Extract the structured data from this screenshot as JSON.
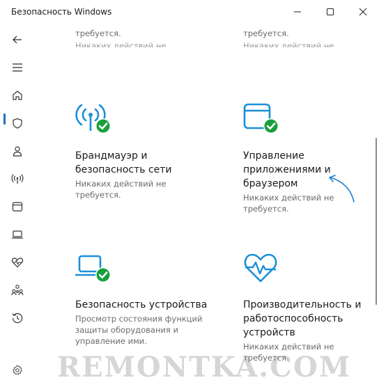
{
  "window": {
    "title": "Безопасность Windows"
  },
  "colors": {
    "accent": "#1f6fbf",
    "check": "#17a03b",
    "icon_blue": "#1a8fd8"
  },
  "sidebar": {
    "items": [
      {
        "icon": "back-arrow-icon"
      },
      {
        "icon": "menu-icon"
      },
      {
        "icon": "home-icon"
      },
      {
        "icon": "shield-icon"
      },
      {
        "icon": "account-icon"
      },
      {
        "icon": "wifi-antenna-icon"
      },
      {
        "icon": "app-browser-icon"
      },
      {
        "icon": "laptop-icon"
      },
      {
        "icon": "heart-pulse-icon"
      },
      {
        "icon": "family-icon"
      },
      {
        "icon": "history-icon"
      },
      {
        "icon": "settings-icon"
      }
    ]
  },
  "top_fragments": {
    "left": "требуется.",
    "right": "требуется.",
    "left_ghost": "Никаких действий не",
    "right_ghost": "Никаких действий не"
  },
  "cards": [
    {
      "icon": "firewall-icon",
      "title_line1": "Брандмауэр и",
      "title_line2": "безопасность сети",
      "desc_line1": "Никаких действий не",
      "desc_line2": "требуется."
    },
    {
      "icon": "app-browser-control-icon",
      "title_line1": "Управление",
      "title_line2": "приложениями и",
      "title_line3": "браузером",
      "desc_line1": "Никаких действий не",
      "desc_line2": "требуется."
    },
    {
      "icon": "device-security-icon",
      "title_line1": "Безопасность устройства",
      "desc_line1": "Просмотр состояния функций",
      "desc_line2": "защиты оборудования и",
      "desc_line3": "управление ими."
    },
    {
      "icon": "device-performance-icon",
      "title_line1": "Производительность и",
      "title_line2": "работоспособность",
      "title_line3": "устройств",
      "desc_line1": "Никаких действий не",
      "desc_line2": "требуется."
    }
  ],
  "watermark": "REMONTKA.COM"
}
